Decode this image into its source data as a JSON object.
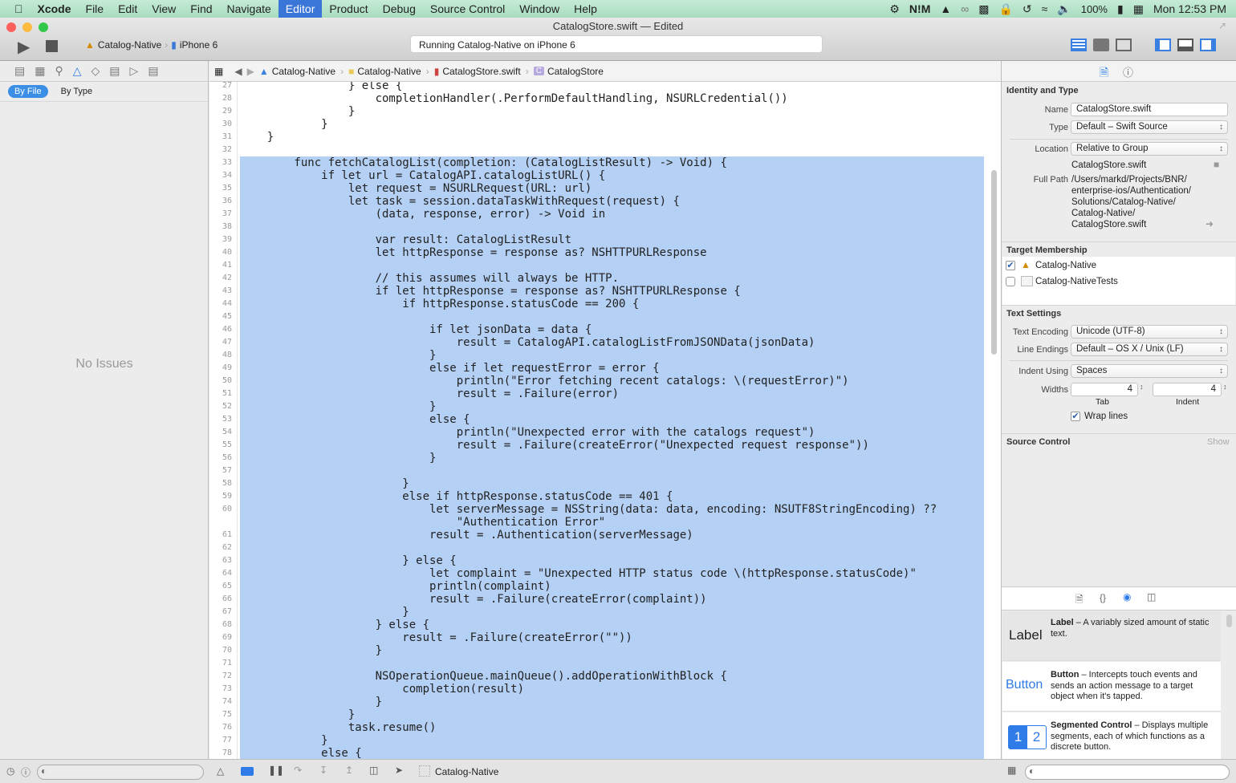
{
  "menubar": {
    "app": "Xcode",
    "items": [
      "File",
      "Edit",
      "View",
      "Find",
      "Navigate",
      "Editor",
      "Product",
      "Debug",
      "Source Control",
      "Window",
      "Help"
    ],
    "active": "Editor",
    "battery": "100%",
    "clock": "Mon 12:53 PM"
  },
  "window": {
    "title": "CatalogStore.swift — Edited",
    "scheme": "Catalog-Native",
    "device": "iPhone 6",
    "activity": "Running Catalog-Native on iPhone 6"
  },
  "navigator": {
    "filters": [
      "By File",
      "By Type"
    ],
    "empty": "No Issues"
  },
  "jumpbar": [
    "Catalog-Native",
    "Catalog-Native",
    "CatalogStore.swift",
    "CatalogStore"
  ],
  "code": [
    {
      "n": "27",
      "t": "                } else {",
      "s": false
    },
    {
      "n": "28",
      "t": "                    completionHandler(.PerformDefaultHandling, NSURLCredential())",
      "s": false
    },
    {
      "n": "29",
      "t": "                }",
      "s": false
    },
    {
      "n": "30",
      "t": "            }",
      "s": false
    },
    {
      "n": "31",
      "t": "    }",
      "s": false
    },
    {
      "n": "32",
      "t": "",
      "s": false
    },
    {
      "n": "33",
      "t": "        func fetchCatalogList(completion: (CatalogListResult) -> Void) {",
      "s": true
    },
    {
      "n": "34",
      "t": "            if let url = CatalogAPI.catalogListURL() {",
      "s": true
    },
    {
      "n": "35",
      "t": "                let request = NSURLRequest(URL: url)",
      "s": true
    },
    {
      "n": "36",
      "t": "                let task = session.dataTaskWithRequest(request) {",
      "s": true
    },
    {
      "n": "37",
      "t": "                    (data, response, error) -> Void in",
      "s": true
    },
    {
      "n": "38",
      "t": "",
      "s": true
    },
    {
      "n": "39",
      "t": "                    var result: CatalogListResult",
      "s": true
    },
    {
      "n": "40",
      "t": "                    let httpResponse = response as? NSHTTPURLResponse",
      "s": true
    },
    {
      "n": "41",
      "t": "",
      "s": true
    },
    {
      "n": "42",
      "t": "                    // this assumes will always be HTTP.",
      "s": true
    },
    {
      "n": "43",
      "t": "                    if let httpResponse = response as? NSHTTPURLResponse {",
      "s": true
    },
    {
      "n": "44",
      "t": "                        if httpResponse.statusCode == 200 {",
      "s": true
    },
    {
      "n": "45",
      "t": "",
      "s": true
    },
    {
      "n": "46",
      "t": "                            if let jsonData = data {",
      "s": true
    },
    {
      "n": "47",
      "t": "                                result = CatalogAPI.catalogListFromJSONData(jsonData)",
      "s": true
    },
    {
      "n": "48",
      "t": "                            }",
      "s": true
    },
    {
      "n": "49",
      "t": "                            else if let requestError = error {",
      "s": true
    },
    {
      "n": "50",
      "t": "                                println(\"Error fetching recent catalogs: \\(requestError)\")",
      "s": true
    },
    {
      "n": "51",
      "t": "                                result = .Failure(error)",
      "s": true
    },
    {
      "n": "52",
      "t": "                            }",
      "s": true
    },
    {
      "n": "53",
      "t": "                            else {",
      "s": true
    },
    {
      "n": "54",
      "t": "                                println(\"Unexpected error with the catalogs request\")",
      "s": true
    },
    {
      "n": "55",
      "t": "                                result = .Failure(createError(\"Unexpected request response\"))",
      "s": true
    },
    {
      "n": "56",
      "t": "                            }",
      "s": true
    },
    {
      "n": "57",
      "t": "",
      "s": true
    },
    {
      "n": "58",
      "t": "                        }",
      "s": true
    },
    {
      "n": "59",
      "t": "                        else if httpResponse.statusCode == 401 {",
      "s": true
    },
    {
      "n": "60",
      "t": "                            let serverMessage = NSString(data: data, encoding: NSUTF8StringEncoding) ??",
      "s": true
    },
    {
      "n": "",
      "t": "                                \"Authentication Error\"",
      "s": true
    },
    {
      "n": "61",
      "t": "                            result = .Authentication(serverMessage)",
      "s": true
    },
    {
      "n": "62",
      "t": "",
      "s": true
    },
    {
      "n": "63",
      "t": "                        } else {",
      "s": true
    },
    {
      "n": "64",
      "t": "                            let complaint = \"Unexpected HTTP status code \\(httpResponse.statusCode)\"",
      "s": true
    },
    {
      "n": "65",
      "t": "                            println(complaint)",
      "s": true
    },
    {
      "n": "66",
      "t": "                            result = .Failure(createError(complaint))",
      "s": true
    },
    {
      "n": "67",
      "t": "                        }",
      "s": true
    },
    {
      "n": "68",
      "t": "                    } else {",
      "s": true
    },
    {
      "n": "69",
      "t": "                        result = .Failure(createError(\"\"))",
      "s": true
    },
    {
      "n": "70",
      "t": "                    }",
      "s": true
    },
    {
      "n": "71",
      "t": "",
      "s": true
    },
    {
      "n": "72",
      "t": "                    NSOperationQueue.mainQueue().addOperationWithBlock {",
      "s": true
    },
    {
      "n": "73",
      "t": "                        completion(result)",
      "s": true
    },
    {
      "n": "74",
      "t": "                    }",
      "s": true
    },
    {
      "n": "75",
      "t": "                }",
      "s": true
    },
    {
      "n": "76",
      "t": "                task.resume()",
      "s": true
    },
    {
      "n": "77",
      "t": "            }",
      "s": true
    },
    {
      "n": "78",
      "t": "            else {",
      "s": true
    }
  ],
  "inspector": {
    "identity": {
      "heading": "Identity and Type",
      "name_label": "Name",
      "name": "CatalogStore.swift",
      "type_label": "Type",
      "type": "Default – Swift Source",
      "location_label": "Location",
      "location": "Relative to Group",
      "filename": "CatalogStore.swift",
      "fullpath_label": "Full Path",
      "fullpath": "/Users/markd/Projects/BNR/\nenterprise-ios/Authentication/\nSolutions/Catalog-Native/\nCatalog-Native/\nCatalogStore.swift"
    },
    "membership": {
      "heading": "Target Membership",
      "targets": [
        {
          "name": "Catalog-Native",
          "checked": true
        },
        {
          "name": "Catalog-NativeTests",
          "checked": false
        }
      ]
    },
    "text": {
      "heading": "Text Settings",
      "encoding_label": "Text Encoding",
      "encoding": "Unicode (UTF-8)",
      "endings_label": "Line Endings",
      "endings": "Default – OS X / Unix (LF)",
      "indent_label": "Indent Using",
      "indent": "Spaces",
      "widths_label": "Widths",
      "tab": "4",
      "indent_width": "4",
      "tab_label": "Tab",
      "indent_width_label": "Indent",
      "wrap": "Wrap lines"
    },
    "source_control": {
      "heading": "Source Control",
      "show": "Show"
    }
  },
  "library": [
    {
      "icon": "Label",
      "title": "Label",
      "desc": " – A variably sized amount of static text."
    },
    {
      "icon": "Button",
      "title": "Button",
      "desc": " – Intercepts touch events and sends an action message to a target object when it's tapped."
    },
    {
      "icon1": "1",
      "icon2": "2",
      "title": "Segmented Control",
      "desc": " – Displays multiple segments, each of which functions as a discrete button."
    }
  ],
  "debugbar": {
    "target": "Catalog-Native"
  }
}
